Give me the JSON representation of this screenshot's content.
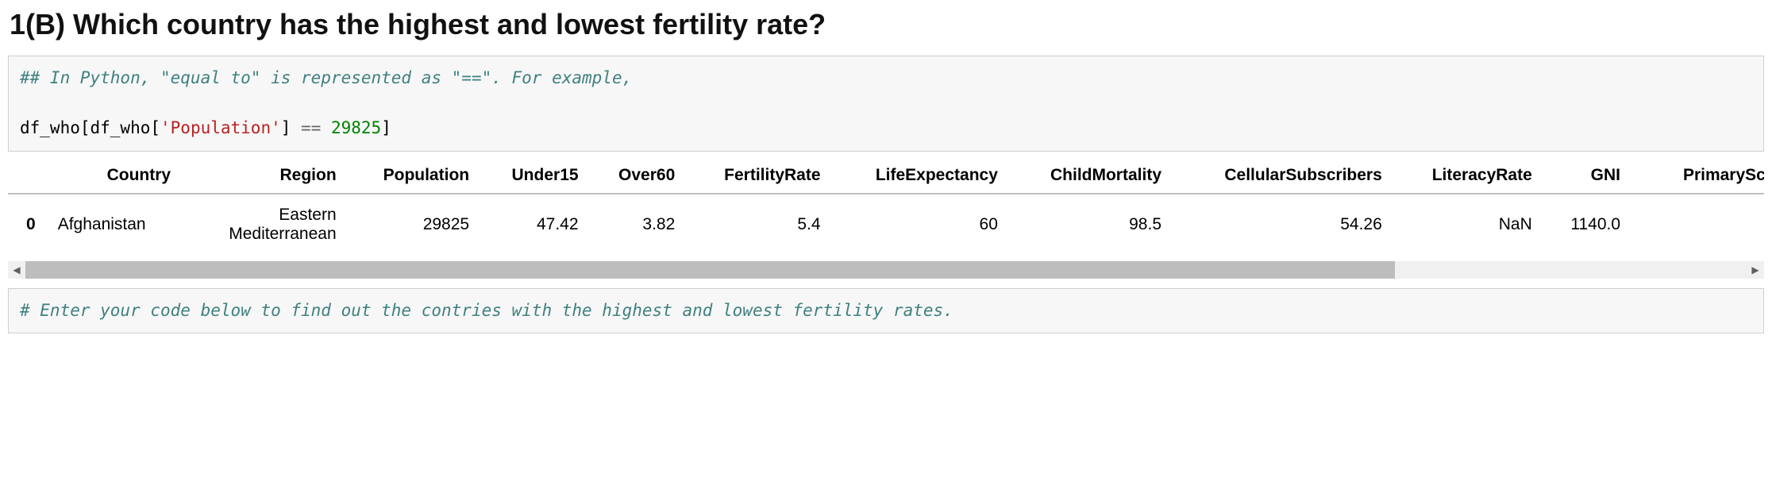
{
  "heading": "1(B) Which country has the highest and lowest fertility rate?",
  "code_cell_1": {
    "comment": "## In Python, \"equal to\" is represented as \"==\". For example,",
    "line2_part1": "df_who[df_who[",
    "line2_string": "'Population'",
    "line2_close_sq": "]",
    "line2_op": " == ",
    "line2_number": "29825",
    "line2_end": "]"
  },
  "table": {
    "headers": [
      "",
      "Country",
      "Region",
      "Population",
      "Under15",
      "Over60",
      "FertilityRate",
      "LifeExpectancy",
      "ChildMortality",
      "CellularSubscribers",
      "LiteracyRate",
      "GNI",
      "PrimarySchoolEnro"
    ],
    "rows": [
      {
        "index": "0",
        "Country": "Afghanistan",
        "Region": "Eastern Mediterranean",
        "Population": "29825",
        "Under15": "47.42",
        "Over60": "3.82",
        "FertilityRate": "5.4",
        "LifeExpectancy": "60",
        "ChildMortality": "98.5",
        "CellularSubscribers": "54.26",
        "LiteracyRate": "NaN",
        "GNI": "1140.0",
        "PrimarySchoolEnro": ""
      }
    ]
  },
  "code_cell_2": {
    "comment": "# Enter your code below to find out the contries with the highest and lowest fertility rates."
  },
  "scroll": {
    "left_arrow": "◀",
    "right_arrow": "▶"
  }
}
